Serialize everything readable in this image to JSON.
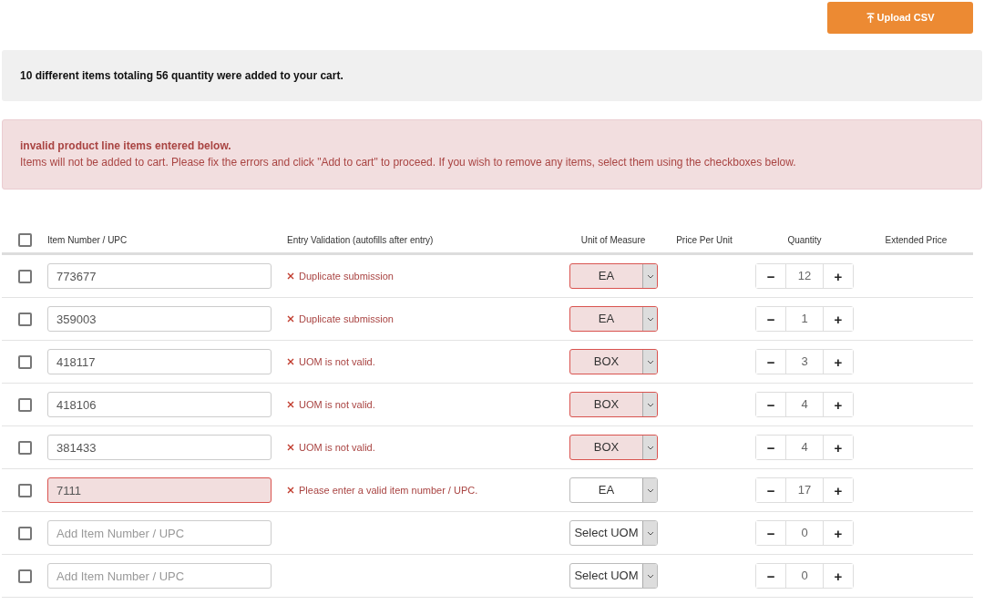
{
  "upload_button": {
    "label": "Upload CSV"
  },
  "summary": "10 different items totaling 56 quantity were added to your cart.",
  "alert": {
    "title": "invalid product line items entered below.",
    "message": "Items will not be added to cart. Please fix the errors and click \"Add to cart\" to proceed. If you wish to remove any items, select them using the checkboxes below."
  },
  "table": {
    "select_all_checked": false,
    "columns": [
      "Item Number / UPC",
      "Entry Validation (autofills after entry)",
      "Unit of Measure",
      "Price Per Unit",
      "Quantity",
      "Extended Price"
    ],
    "rows": [
      {
        "checked": false,
        "item": "773677",
        "item_invalid": false,
        "validation": "Duplicate submission",
        "uom": "EA",
        "uom_invalid": true,
        "minus": "−",
        "quantity": "12",
        "plus": "+"
      },
      {
        "checked": false,
        "item": "359003",
        "item_invalid": false,
        "validation": "Duplicate submission",
        "uom": "EA",
        "uom_invalid": true,
        "minus": "−",
        "quantity": "1",
        "plus": "+"
      },
      {
        "checked": false,
        "item": "418117",
        "item_invalid": false,
        "validation": "UOM is not valid.",
        "uom": "BOX",
        "uom_invalid": true,
        "minus": "−",
        "quantity": "3",
        "plus": "+"
      },
      {
        "checked": false,
        "item": "418106",
        "item_invalid": false,
        "validation": "UOM is not valid.",
        "uom": "BOX",
        "uom_invalid": true,
        "minus": "−",
        "quantity": "4",
        "plus": "+"
      },
      {
        "checked": false,
        "item": "381433",
        "item_invalid": false,
        "validation": "UOM is not valid.",
        "uom": "BOX",
        "uom_invalid": true,
        "minus": "−",
        "quantity": "4",
        "plus": "+"
      },
      {
        "checked": false,
        "item": "7111",
        "item_invalid": true,
        "validation": "Please enter a valid item number / UPC.",
        "uom": "EA",
        "uom_invalid": false,
        "minus": "−",
        "quantity": "17",
        "plus": "+"
      },
      {
        "checked": false,
        "placeholder": "Add Item Number / UPC",
        "item_invalid": false,
        "uom": "Select UOM",
        "uom_invalid": false,
        "minus": "−",
        "quantity": "0",
        "plus": "+"
      },
      {
        "checked": false,
        "placeholder": "Add Item Number / UPC",
        "item_invalid": false,
        "uom": "Select UOM",
        "uom_invalid": false,
        "minus": "−",
        "quantity": "0",
        "plus": "+"
      }
    ]
  }
}
